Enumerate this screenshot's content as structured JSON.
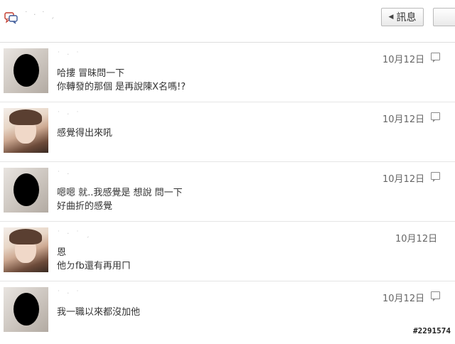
{
  "header": {
    "message_button": "訊息",
    "icon": "chat-bubbles-icon"
  },
  "messages": [
    {
      "avatar": "masked-avatar",
      "time": "10月12日",
      "lines": [
        "哈摟 冒昧問一下",
        "你轉發的那個 是再說陳X名嗎!?"
      ],
      "reply_icon": true
    },
    {
      "avatar": "photo-avatar",
      "time": "10月12日",
      "lines": [
        "感覺得出來吼"
      ],
      "reply_icon": true
    },
    {
      "avatar": "masked-avatar",
      "time": "10月12日",
      "lines": [
        "嗯嗯 就..我感覺是 想說 問一下",
        "好曲折的感覺"
      ],
      "reply_icon": true
    },
    {
      "avatar": "photo-avatar",
      "time": "10月12日",
      "lines": [
        "恩",
        "他ㄉfb還有再用ㄇ"
      ],
      "reply_icon": false
    },
    {
      "avatar": "masked-avatar",
      "time": "10月12日",
      "lines": [
        "我一職以來都沒加他"
      ],
      "reply_icon": true
    }
  ],
  "watermark": "#2291574"
}
